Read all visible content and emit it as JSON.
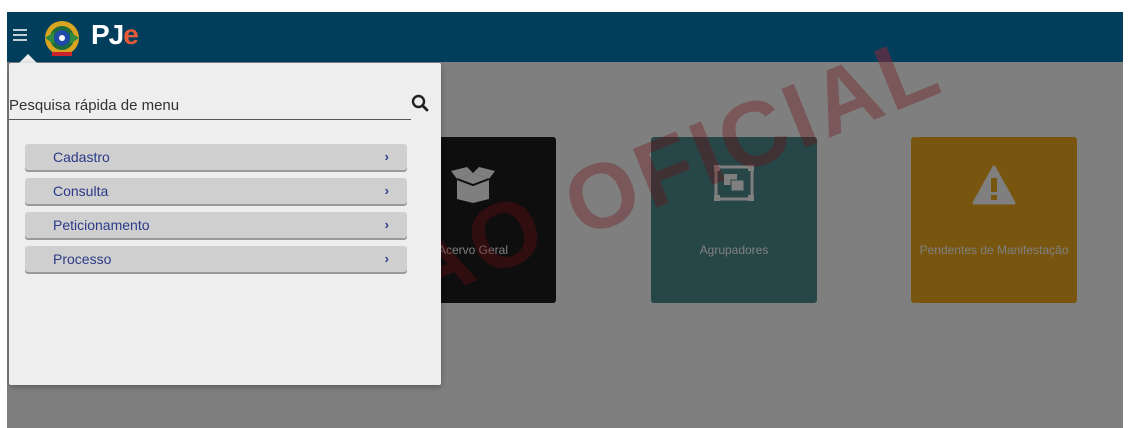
{
  "app": {
    "logo_text_main": "PJ",
    "logo_text_accent": "e"
  },
  "colors": {
    "topbar": "#003e5c",
    "menu_text": "#2b3a88",
    "watermark": "#e11b22",
    "card_acervo": "#1c1c1c",
    "card_agrupadores": "#4e8d8e",
    "card_pendentes": "#f0ad1f"
  },
  "menu": {
    "search": {
      "placeholder": "Pesquisa rápida de menu",
      "value": ""
    },
    "items": [
      {
        "label": "Cadastro",
        "arrow": "›"
      },
      {
        "label": "Consulta",
        "arrow": "›"
      },
      {
        "label": "Peticionamento",
        "arrow": "›"
      },
      {
        "label": "Processo",
        "arrow": "›"
      }
    ]
  },
  "cards": [
    {
      "title": "Acervo Geral",
      "icon": "open-box-icon"
    },
    {
      "title": "Agrupadores",
      "icon": "group-squares-icon"
    },
    {
      "title": "Pendentes de Manifestação",
      "icon": "warning-triangle-icon"
    }
  ],
  "watermark": {
    "text": "ÃO OFICIAL"
  }
}
